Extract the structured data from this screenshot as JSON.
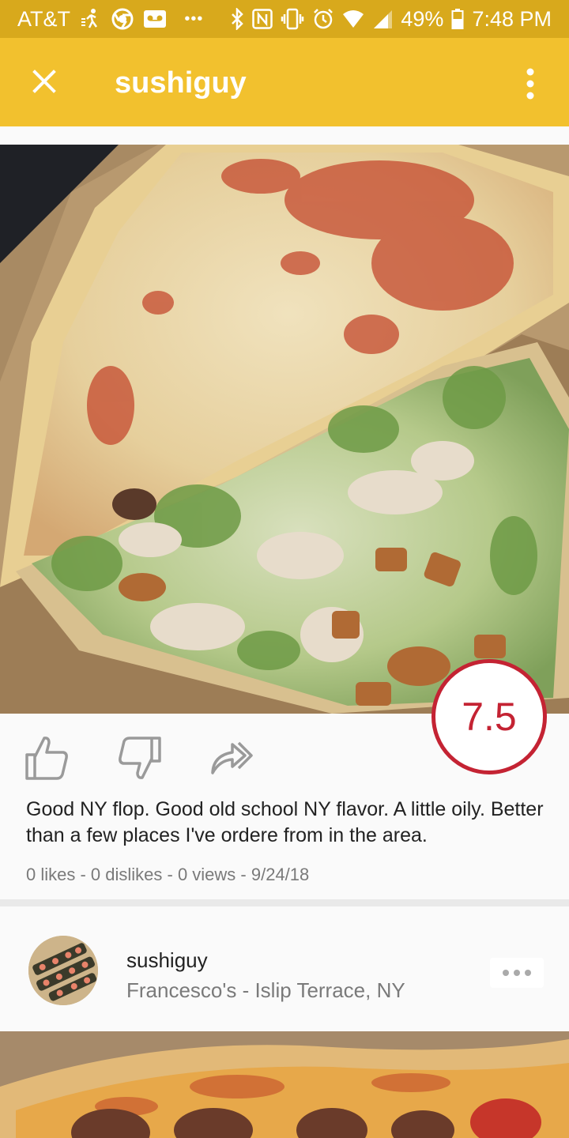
{
  "status_bar": {
    "carrier": "AT&T",
    "battery": "49%",
    "time": "7:48 PM",
    "icons": [
      "walking-icon",
      "chrome-icon",
      "voicemail-icon",
      "more-icon",
      "bluetooth-icon",
      "nfc-icon",
      "vibrate-icon",
      "alarm-icon",
      "wifi-icon",
      "signal-icon",
      "battery-icon"
    ]
  },
  "app_bar": {
    "title": "sushiguy"
  },
  "post": {
    "rating": "7.5",
    "review": "Good NY flop. Good old school NY flavor. A little oily. Better than a few places I've ordere from in the area.",
    "stats": "0 likes - 0 dislikes - 0 views - 9/24/18",
    "actions": [
      "thumbs-up-icon",
      "thumbs-down-icon",
      "share-icon"
    ]
  },
  "next_post": {
    "username": "sushiguy",
    "place": "Francesco's - Islip Terrace, NY"
  },
  "colors": {
    "status_bar": "#d8a91c",
    "app_bar": "#f2c12e",
    "rating_red": "#c42333"
  }
}
